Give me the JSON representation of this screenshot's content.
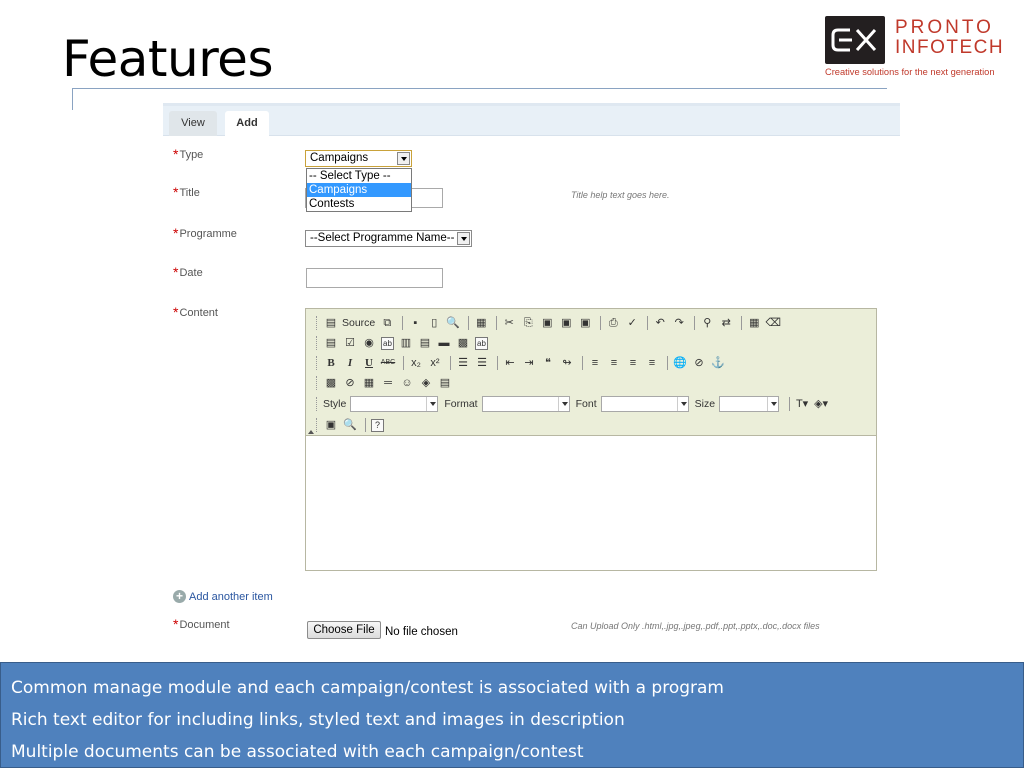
{
  "slide": {
    "title": "Features",
    "logo": {
      "name_line1": "PRONTO",
      "name_line2": "INFOTECH",
      "tagline": "Creative solutions for the next generation"
    }
  },
  "tabs": [
    {
      "label": "View",
      "active": false
    },
    {
      "label": "Add",
      "active": true
    }
  ],
  "form": {
    "required_mark": "*",
    "type": {
      "label": "Type",
      "selected": "Campaigns",
      "options": [
        "-- Select Type --",
        "Campaigns",
        "Contests"
      ],
      "highlighted_option": "Campaigns"
    },
    "title": {
      "label": "Title",
      "value": "",
      "help": "Title help text goes here."
    },
    "programme": {
      "label": "Programme",
      "selected": "--Select Programme Name--"
    },
    "date": {
      "label": "Date",
      "value": ""
    },
    "content": {
      "label": "Content",
      "toolbar": {
        "source_label": "Source",
        "style_label": "Style",
        "format_label": "Format",
        "font_label": "Font",
        "size_label": "Size",
        "bold": "B",
        "italic": "I",
        "underline": "U",
        "help": "?"
      }
    },
    "add_another": "Add another item",
    "document": {
      "label": "Document",
      "button": "Choose File",
      "status": "No file chosen",
      "help": "Can Upload Only .html,.jpg,.jpeg,.pdf,.ppt,.pptx,.doc,.docx files"
    }
  },
  "bullets": [
    "Common manage module and each campaign/contest is associated with a program",
    "Rich text editor for including links, styled text and images in description",
    "Multiple documents can be associated with each campaign/contest"
  ],
  "colors": {
    "bullet_box": "#4f81bd",
    "logo_red": "#c0392b",
    "required": "#cc0000",
    "toolbar_bg": "#ebeed9",
    "option_highlight": "#3399ff"
  }
}
